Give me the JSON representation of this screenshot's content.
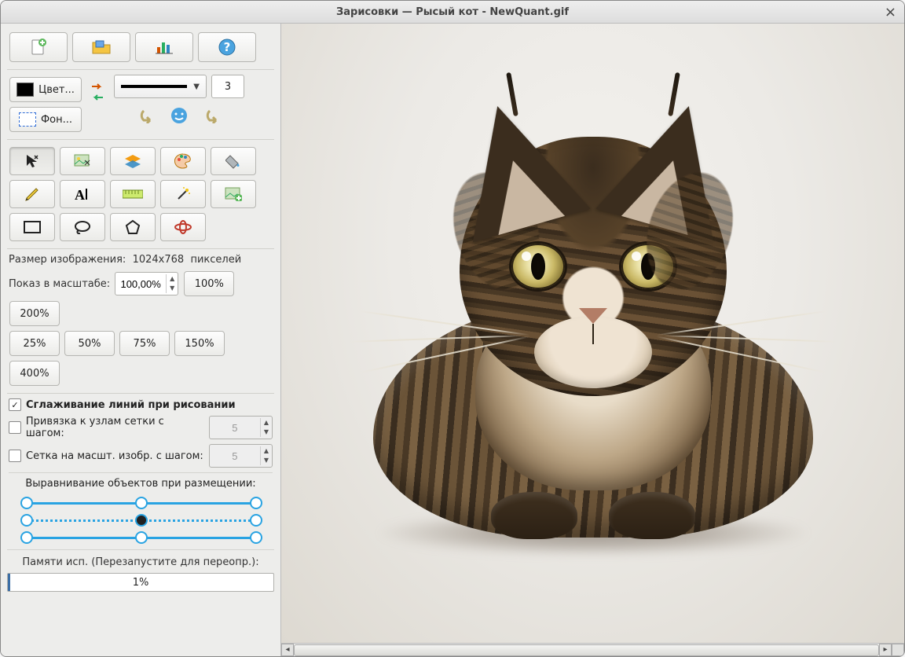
{
  "window": {
    "title": "Зарисовки — Рысый кот - NewQuant.gif"
  },
  "topbar": {
    "new_icon": "new-file-icon",
    "open_icon": "open-folder-icon",
    "chart_icon": "chart-icon",
    "help_icon": "help-icon"
  },
  "colors": {
    "fg_label": "Цвет...",
    "bg_label": "Фон...",
    "line_width": "3"
  },
  "history": {
    "undo_icon": "undo-icon",
    "face_icon": "face-icon",
    "redo_icon": "redo-icon"
  },
  "tools": [
    "select-arrow",
    "select-image",
    "layers",
    "palette",
    "fill-bucket",
    "pencil",
    "text",
    "ruler",
    "wand",
    "crop-image",
    "rectangle",
    "lasso",
    "polygon",
    "mesh"
  ],
  "image_info": {
    "size_label": "Размер изображения:",
    "size_value": "1024x768",
    "size_unit": "пикселей",
    "zoom_label": "Показ в масштабе:",
    "zoom_value": "100,00%",
    "presets": [
      "100%",
      "200%",
      "25%",
      "50%",
      "75%",
      "150%",
      "400%"
    ]
  },
  "options": {
    "antialias": {
      "checked": true,
      "label": "Сглаживание линий при рисовании"
    },
    "grid_snap": {
      "checked": false,
      "label": "Привязка к узлам сетки с шагом:",
      "value": "5"
    },
    "grid_show": {
      "checked": false,
      "label": "Сетка на масшт. изобр. с шагом:",
      "value": "5"
    }
  },
  "align": {
    "title": "Выравнивание объектов при размещении:"
  },
  "memory": {
    "title": "Памяти исп. (Перезапустите для переопр.):",
    "percent_text": "1%",
    "percent": 1
  }
}
